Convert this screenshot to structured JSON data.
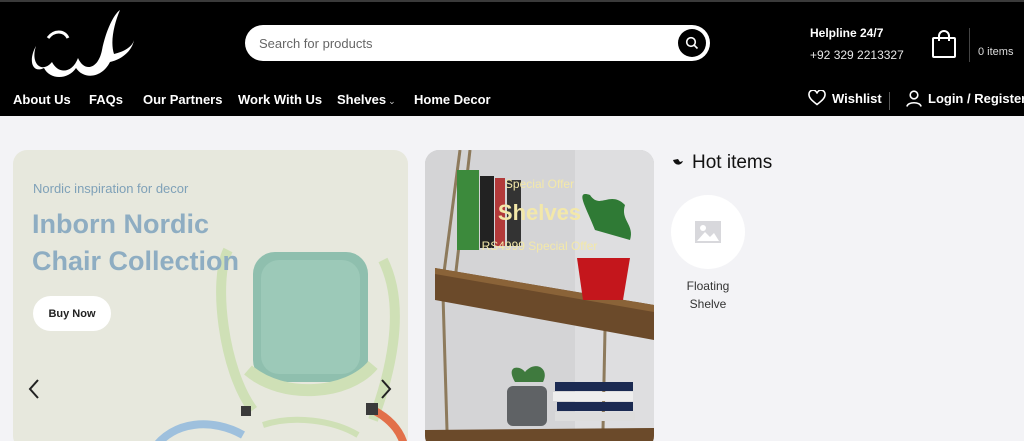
{
  "header": {
    "search_placeholder": "Search for products",
    "helpline_title": "Helpline 24/7",
    "helpline_phone": "+92 329 2213327",
    "cart_count": "0 items"
  },
  "nav": {
    "items": [
      {
        "label": "About Us"
      },
      {
        "label": "FAQs"
      },
      {
        "label": "Our Partners"
      },
      {
        "label": "Work With Us"
      },
      {
        "label": "Shelves",
        "has_dropdown": true
      },
      {
        "label": "Home Decor"
      }
    ],
    "wishlist": "Wishlist",
    "login": "Login / Register"
  },
  "banner1": {
    "subtitle": "Nordic inspiration for decor",
    "title": "Inborn Nordic Chair Collection",
    "button": "Buy Now"
  },
  "banner2": {
    "offer": "Special Offer",
    "title": "Shelves",
    "price": "RS4999  Special Offer"
  },
  "hot_items": {
    "title": "Hot items",
    "items": [
      {
        "label": "Floating Shelve"
      }
    ]
  },
  "colors": {
    "header_bg": "#000000",
    "page_bg": "#f3f3f6",
    "banner1_bg": "#e7e8dd",
    "banner1_text": "#8eadc2",
    "offer_text": "#f3e8a9"
  }
}
